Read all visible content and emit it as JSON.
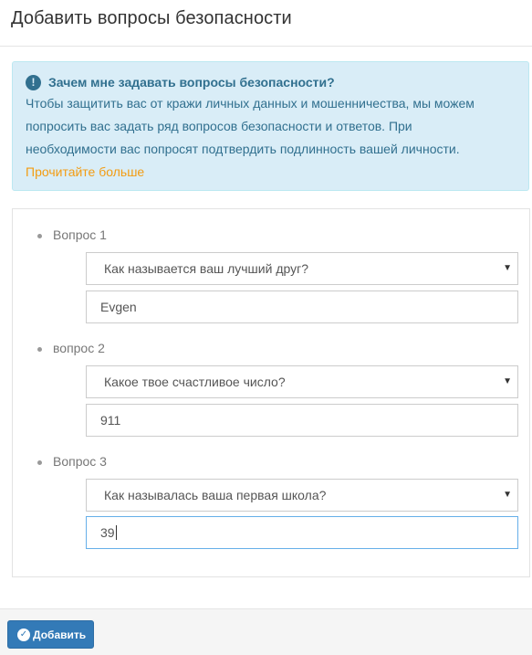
{
  "header": {
    "title": "Добавить вопросы безопасности"
  },
  "info": {
    "icon": "exclamation-circle-icon",
    "title": "Зачем мне задавать вопросы безопасности?",
    "body": "Чтобы защитить вас от кражи личных данных и мошенничества, мы можем попросить вас задать ряд вопросов безопасности и ответов. При необходимости вас попросят подтвердить подлинность вашей личности.",
    "read_more": "Прочитайте больше"
  },
  "questions": [
    {
      "label": "Вопрос 1",
      "selected": "Как называется ваш лучший друг?",
      "answer": "Evgen"
    },
    {
      "label": "вопрос 2",
      "selected": "Какое твое счастливое число?",
      "answer": "911"
    },
    {
      "label": "Вопрос 3",
      "selected": "Как называлась ваша первая школа?",
      "answer": "39"
    }
  ],
  "footer": {
    "submit_label": "Добавить",
    "submit_icon": "check-circle-icon"
  }
}
